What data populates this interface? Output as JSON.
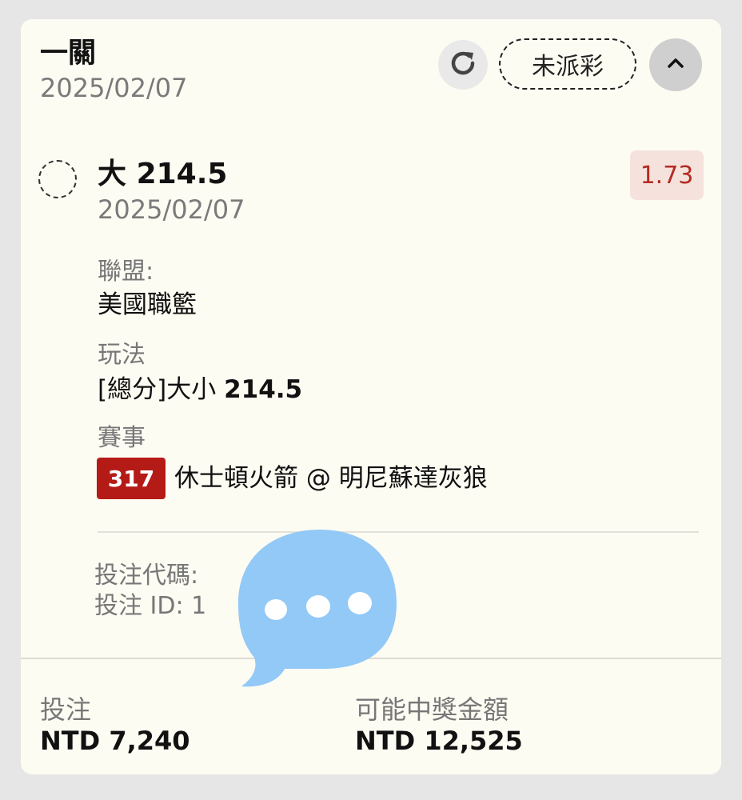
{
  "header": {
    "title": "一關",
    "date": "2025/02/07",
    "status": "未派彩",
    "refresh_icon": "refresh-icon",
    "collapse_icon": "chevron-up-icon"
  },
  "selection": {
    "name_prefix": "大",
    "line": "214.5",
    "date": "2025/02/07",
    "odds": "1.73"
  },
  "details": {
    "league_label": "聯盟:",
    "league_value": "美國職籃",
    "market_label": "玩法",
    "market_value_prefix": "[總分]大小",
    "market_value_line": "214.5",
    "event_label": "賽事",
    "event_number": "317",
    "event_name": "休士頓火箭 @ 明尼蘇達灰狼"
  },
  "meta": {
    "bet_code": "投注代碼:",
    "bet_id": "投注 ID: 1"
  },
  "footer": {
    "stake_label": "投注",
    "stake_value": "NTD 7,240",
    "payout_label": "可能中獎金額",
    "payout_value": "NTD 12,525"
  },
  "overlay": {
    "chat_icon": "chat-bubble-icon"
  },
  "colors": {
    "card_bg": "#fdfcf3",
    "odds_text": "#b32b22",
    "odds_bg": "#f6e2dc",
    "event_badge": "#b51b16",
    "chat_bubble": "#92c9f7"
  }
}
